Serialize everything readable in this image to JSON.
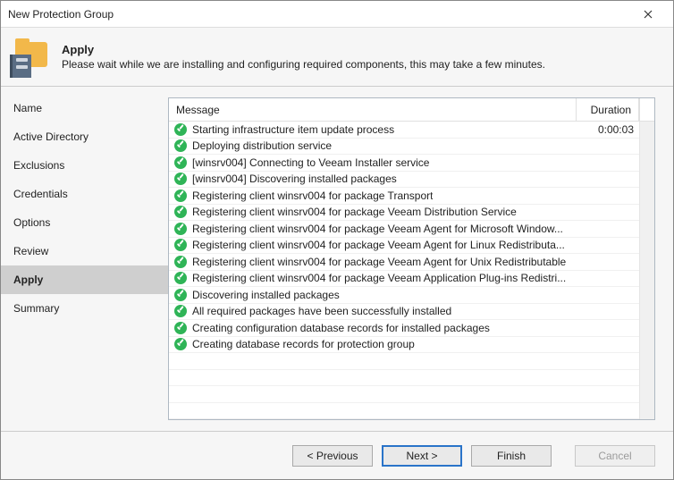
{
  "window": {
    "title": "New Protection Group"
  },
  "header": {
    "title": "Apply",
    "description": "Please wait while we are installing and configuring required components, this may take a few minutes."
  },
  "sidebar": {
    "items": [
      {
        "label": "Name"
      },
      {
        "label": "Active Directory"
      },
      {
        "label": "Exclusions"
      },
      {
        "label": "Credentials"
      },
      {
        "label": "Options"
      },
      {
        "label": "Review"
      },
      {
        "label": "Apply"
      },
      {
        "label": "Summary"
      }
    ],
    "selected_index": 6
  },
  "grid": {
    "columns": {
      "message": "Message",
      "duration": "Duration"
    },
    "rows": [
      {
        "status": "ok",
        "message": "Starting infrastructure item update process",
        "duration": "0:00:03"
      },
      {
        "status": "ok",
        "message": "Deploying distribution service",
        "duration": ""
      },
      {
        "status": "ok",
        "message": "[winsrv004] Connecting to Veeam Installer service",
        "duration": ""
      },
      {
        "status": "ok",
        "message": "[winsrv004] Discovering installed packages",
        "duration": ""
      },
      {
        "status": "ok",
        "message": "Registering client winsrv004 for package Transport",
        "duration": ""
      },
      {
        "status": "ok",
        "message": "Registering client winsrv004 for package Veeam Distribution Service",
        "duration": ""
      },
      {
        "status": "ok",
        "message": "Registering client winsrv004 for package Veeam Agent for Microsoft Window...",
        "duration": ""
      },
      {
        "status": "ok",
        "message": "Registering client winsrv004 for package Veeam Agent for Linux Redistributa...",
        "duration": ""
      },
      {
        "status": "ok",
        "message": "Registering client winsrv004 for package Veeam Agent for Unix Redistributable",
        "duration": ""
      },
      {
        "status": "ok",
        "message": "Registering client winsrv004 for package Veeam Application Plug-ins Redistri...",
        "duration": ""
      },
      {
        "status": "ok",
        "message": "Discovering installed packages",
        "duration": ""
      },
      {
        "status": "ok",
        "message": "All required packages have been successfully installed",
        "duration": ""
      },
      {
        "status": "ok",
        "message": "Creating configuration database records for installed packages",
        "duration": ""
      },
      {
        "status": "ok",
        "message": "Creating database records for protection group",
        "duration": ""
      }
    ]
  },
  "footer": {
    "previous": "< Previous",
    "next": "Next >",
    "finish": "Finish",
    "cancel": "Cancel"
  }
}
